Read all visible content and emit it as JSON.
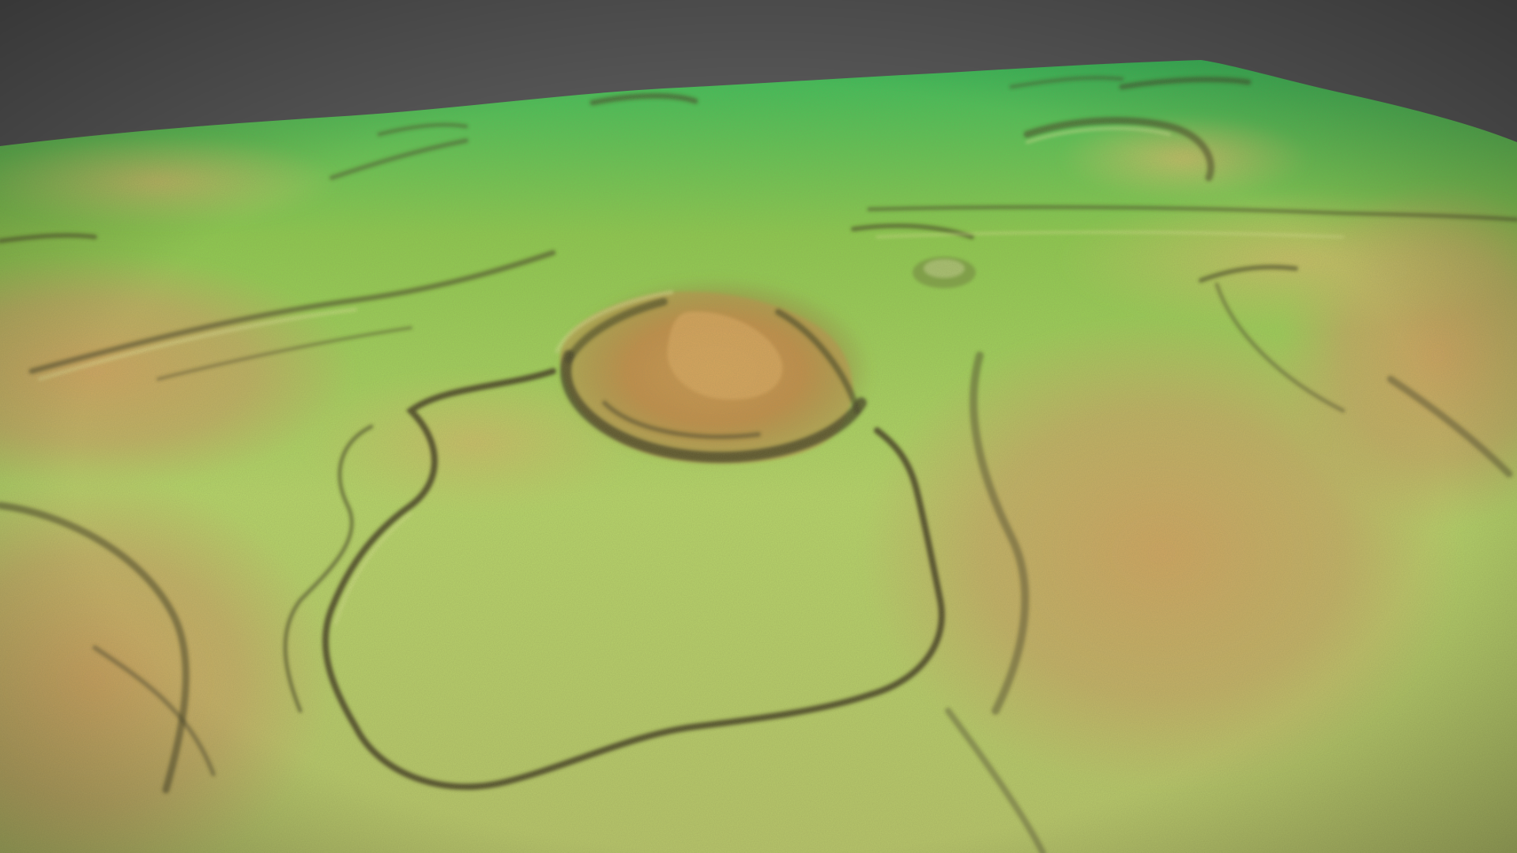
{
  "scene": {
    "kind": "3d-lidar-terrain-render",
    "background_color": "#555555",
    "colors": {
      "low_green": "#2fbf5a",
      "mid_green": "#8ccc4e",
      "light_green": "#b7d86a",
      "yellow_green": "#c7c767",
      "tan": "#caa565",
      "ochre": "#c58a45",
      "dark_ridge": "#3e3a22",
      "shadow": "#4a4a2a"
    }
  }
}
